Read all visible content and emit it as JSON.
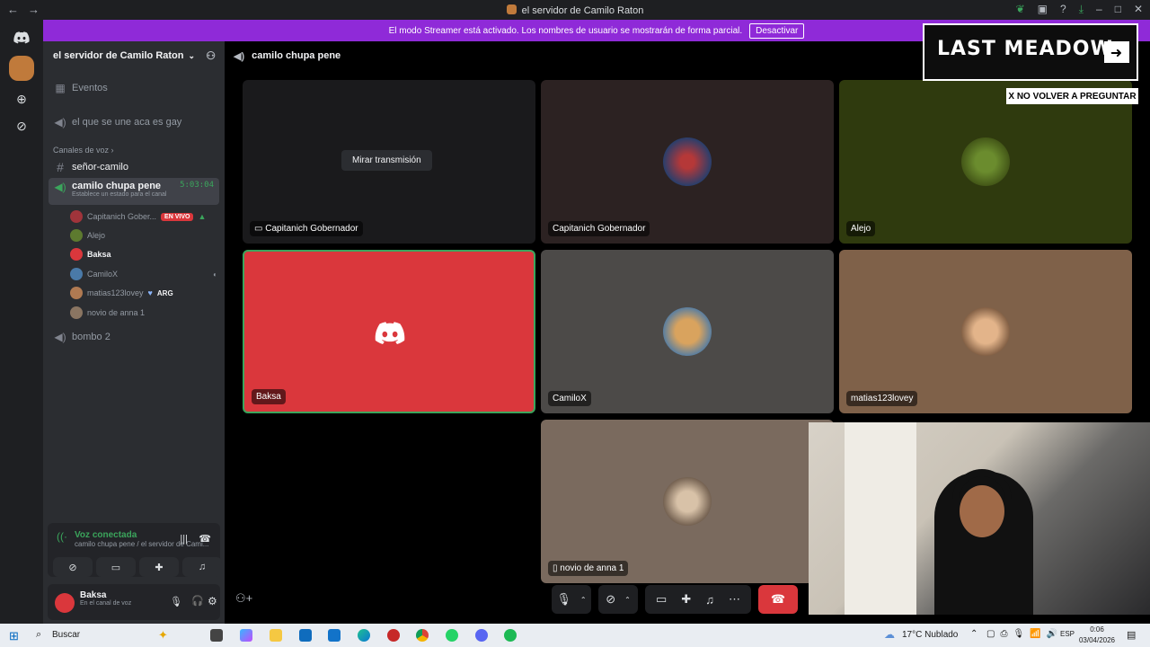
{
  "titlebar": {
    "title": "el servidor de Camilo Raton",
    "back": "←",
    "forward": "→"
  },
  "banner": {
    "text": "El modo Streamer está activado. Los nombres de usuario se mostrarán de forma parcial.",
    "button": "Desactivar"
  },
  "server": {
    "name": "el servidor de Camilo Raton"
  },
  "channels": {
    "events": "Eventos",
    "voice1": "el que se une aca es gay",
    "category": "Canales de voz",
    "text1": "señor-camilo",
    "active": "camilo chupa pene",
    "active_timer": "5:03:04",
    "active_status": "Establece un estado para el canal",
    "voice3": "bombo 2"
  },
  "members": [
    {
      "name": "Capitanich Gober...",
      "badge": "EN VIVO",
      "color": "#a0343b"
    },
    {
      "name": "Alejo",
      "color": "#5d7a2f"
    },
    {
      "name": "Baksa",
      "color": "#da373c"
    },
    {
      "name": "CamiloX",
      "color": "#4a7aa8"
    },
    {
      "name": "matias123lovey",
      "tag": "ARG",
      "color": "#b07a52"
    },
    {
      "name": "novio de anna 1",
      "color": "#8a7562"
    }
  ],
  "voice_panel": {
    "title": "Voz conectada",
    "subtitle": "camilo chupa pene / el servidor de Cami..."
  },
  "user": {
    "name": "Baksa",
    "status": "En el canal de voz"
  },
  "call": {
    "header": "camilo chupa pene",
    "watch_button": "Mirar transmisión",
    "tiles": [
      {
        "label": "Capitanich Gobernador",
        "bg": "#1a1a1c"
      },
      {
        "label": "Capitanich Gobernador",
        "bg": "#2c2222"
      },
      {
        "label": "Alejo",
        "bg": "#2f3a0e"
      },
      {
        "label": "Baksa",
        "bg": "#da373c"
      },
      {
        "label": "CamiloX",
        "bg": "#4c4a48"
      },
      {
        "label": "matias123lovey",
        "bg": "#7f6149"
      },
      {
        "label": "novio de anna 1",
        "bg": "#7a6a5e"
      }
    ]
  },
  "ad": {
    "title": "LAST MEADOW",
    "dismiss": "X NO VOLVER A PREGUNTAR"
  },
  "taskbar": {
    "search": "Buscar",
    "weather": "17°C  Nublado",
    "lang": "ESP",
    "time": "0:06",
    "date": "03/04/2026"
  }
}
